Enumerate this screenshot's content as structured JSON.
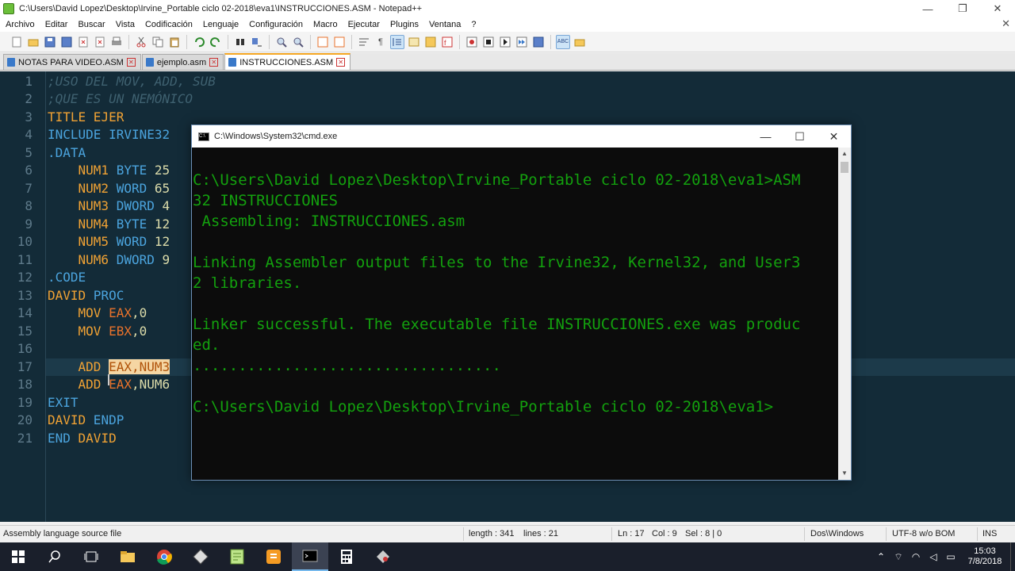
{
  "window": {
    "title": "C:\\Users\\David Lopez\\Desktop\\Irvine_Portable ciclo 02-2018\\eva1\\INSTRUCCIONES.ASM - Notepad++",
    "minimize": "—",
    "maximize": "❐",
    "close": "✕"
  },
  "menu": {
    "items": [
      "Archivo",
      "Editar",
      "Buscar",
      "Vista",
      "Codificación",
      "Lenguaje",
      "Configuración",
      "Macro",
      "Ejecutar",
      "Plugins",
      "Ventana",
      "?"
    ],
    "close": "✕"
  },
  "tabs": [
    {
      "label": "NOTAS PARA VIDEO.ASM",
      "active": false
    },
    {
      "label": "ejemplo.asm",
      "active": false
    },
    {
      "label": "INSTRUCCIONES.ASM",
      "active": true
    }
  ],
  "editor": {
    "line_numbers": [
      "1",
      "2",
      "3",
      "4",
      "5",
      "6",
      "7",
      "8",
      "9",
      "10",
      "11",
      "12",
      "13",
      "14",
      "15",
      "16",
      "17",
      "18",
      "19",
      "20",
      "21"
    ],
    "lines": {
      "l1": ";USO DEL MOV, ADD, SUB",
      "l2": ";QUE ES UN NEMÓNICO",
      "l3a": "TITLE",
      "l3b": " EJER",
      "l4a": "INCLUDE",
      "l4b": " IRVINE32",
      "l5": ".DATA",
      "l6a": "    NUM1 ",
      "l6b": "BYTE",
      "l6c": " 25",
      "l7a": "    NUM2 ",
      "l7b": "WORD",
      "l7c": " 65",
      "l8a": "    NUM3 ",
      "l8b": "DWORD",
      "l8c": " 4",
      "l9a": "    NUM4 ",
      "l9b": "BYTE",
      "l9c": " 12",
      "l10a": "    NUM5 ",
      "l10b": "WORD",
      "l10c": " 12",
      "l11a": "    NUM6 ",
      "l11b": "DWORD",
      "l11c": " 9",
      "l12": ".CODE",
      "l13a": "DAVID",
      "l13b": " PROC",
      "l14a": "    MOV ",
      "l14b": "EAX",
      "l14c": ",0",
      "l15a": "    MOV ",
      "l15b": "EBX",
      "l15c": ",0",
      "l17a": "    ADD ",
      "l17b": "EAX",
      "l17c": ",NUM3",
      "l18a": "    ADD ",
      "l18b": "EAX",
      "l18c": ",NUM6",
      "l19": "EXIT",
      "l20a": "DAVID",
      "l20b": " ENDP",
      "l21a": "END",
      "l21b": " DAVID"
    }
  },
  "cmd": {
    "title": "C:\\Windows\\System32\\cmd.exe",
    "minimize": "—",
    "maximize": "☐",
    "close": "✕",
    "output": "C:\\Users\\David Lopez\\Desktop\\Irvine_Portable ciclo 02-2018\\eva1>ASM\n32 INSTRUCCIONES\n Assembling: INSTRUCCIONES.asm\n\nLinking Assembler output files to the Irvine32, Kernel32, and User3\n2 libraries.\n\nLinker successful. The executable file INSTRUCCIONES.exe was produc\ned.\n..................................\n\nC:\\Users\\David Lopez\\Desktop\\Irvine_Portable ciclo 02-2018\\eva1>"
  },
  "status": {
    "file_type": "Assembly language source file",
    "length": "length : 341",
    "lines": "lines : 21",
    "ln": "Ln : 17",
    "col": "Col : 9",
    "sel": "Sel : 8 | 0",
    "eol": "Dos\\Windows",
    "encoding": "UTF-8 w/o BOM",
    "mode": "INS"
  },
  "taskbar": {
    "time": "15:03",
    "date": "7/8/2018"
  },
  "colors": {
    "editor_bg": "#132b38",
    "cmd_text": "#13a10e",
    "keyword": "#f0a234",
    "directive": "#4ba4de",
    "register": "#e8722b"
  }
}
